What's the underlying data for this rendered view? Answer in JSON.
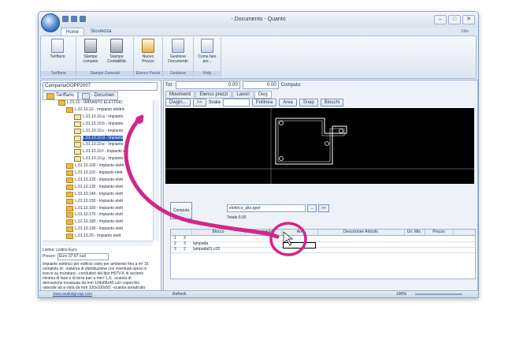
{
  "window": {
    "title": "- Documento - Quanto",
    "ribbon_style": "Stile"
  },
  "ribbon_tabs": [
    "Home",
    "Sicurezza"
  ],
  "ribbon": {
    "buttons": [
      {
        "label": "Tariffario",
        "icon": "tariffario-icon"
      },
      {
        "label": "Stampe computo",
        "icon": "printer-icon"
      },
      {
        "label": "Stampe Contabilità",
        "icon": "printer-icon"
      },
      {
        "label": "Nuovo Prezzo",
        "icon": "new-price-icon"
      },
      {
        "label": "Gestione Documento",
        "icon": "document-icon"
      },
      {
        "label": "Come fare per...",
        "icon": "help-icon"
      }
    ],
    "groups": [
      "Tariffario",
      "Stampe Generali",
      "Elenco Prezzi",
      "Gestione",
      "Help"
    ]
  },
  "left": {
    "combo_value": "CampaniaGOPP2007",
    "tabs": [
      "Tariffario",
      "- Documen"
    ],
    "tree": [
      {
        "text": "L.01.10 - IMPIANTO ELETTRIC",
        "indent": 2,
        "icon": "folder"
      },
      {
        "text": "L.01.10.10 - Impianto elettric",
        "indent": 3,
        "icon": "folder"
      },
      {
        "text": "L.01.10.10.a - Impianto",
        "indent": 4,
        "icon": "item"
      },
      {
        "text": "L.01.10.10.b - Impianto",
        "indent": 4,
        "icon": "item"
      },
      {
        "text": "L.01.10.10.c - Impianto",
        "indent": 4,
        "icon": "item"
      },
      {
        "text": "L.01.10.10.d - Impianto",
        "indent": 4,
        "icon": "item",
        "selected": true
      },
      {
        "text": "L.01.10.10.e - Impianto",
        "indent": 4,
        "icon": "item"
      },
      {
        "text": "L.01.10.10.f - Impianto e",
        "indent": 4,
        "icon": "item"
      },
      {
        "text": "L.01.10.10.g - Impianto",
        "indent": 4,
        "icon": "item"
      },
      {
        "text": "L.01.10.100 - Impianto elettr",
        "indent": 3,
        "icon": "folder"
      },
      {
        "text": "L.01.10.110 - Impianto elett",
        "indent": 3,
        "icon": "folder"
      },
      {
        "text": "L.01.10.120 - Impianto elett",
        "indent": 3,
        "icon": "folder"
      },
      {
        "text": "L.01.10.130 - Impianto elett",
        "indent": 3,
        "icon": "folder"
      },
      {
        "text": "L.01.10.140 - Impianto elett",
        "indent": 3,
        "icon": "folder"
      },
      {
        "text": "L.01.10.150 - Impianto elett",
        "indent": 3,
        "icon": "folder"
      },
      {
        "text": "L.01.10.160 - Impianto elett",
        "indent": 3,
        "icon": "folder"
      },
      {
        "text": "L.01.10.170 - Impianto elett",
        "indent": 3,
        "icon": "folder"
      },
      {
        "text": "L.01.10.180 - Impianto elett",
        "indent": 3,
        "icon": "folder"
      },
      {
        "text": "L.01.10.190 - Impianto elett",
        "indent": 3,
        "icon": "folder"
      },
      {
        "text": "L.01.10.20 - Impianto elett",
        "indent": 3,
        "icon": "folder"
      }
    ],
    "listino_label": "Listino:",
    "listino_value": "Listino Euro",
    "prezzo_label": "Prezzo:",
    "prezzo_value": "Euro 37.97 cad",
    "description": "Impianto elettrico per edificio civile per ambiente fino a m² 16 completo di: -sistema di distribuzione con eventuali opere in tracce su muratura; -conduttori del tipo H07V-K di sezione minima di fase e di terra pari a mm² 1,5; -scatola di derivazione incassata da mm 104x68x45 con coperchio opposte ad a vista da mm 100x100x50; -scatola portafrutto incassata a muro 3 posti oppure se a vista da mm 86x52; -supporto 1 posto con viti vincolanti per scatola 3 posti; -frutto, serie commerciale; -placca in materiale plastico o"
  },
  "right": {
    "tot_label": "Tot:",
    "tot_value1": "0.00",
    "tot_value2": "0.00",
    "computo_label": "Computo:",
    "tabs": [
      "Movimenti",
      "Elenco prezzi",
      "Lavori",
      "Dwg"
    ],
    "dwg_buttons": {
      "dwgin": "Dwgin...",
      "next": ">>",
      "scala": "Scala",
      "pollinea": "Pollinea",
      "area": "Area",
      "snap": "Snap",
      "blocchi": "Blocchi"
    },
    "computa_label": "Computa",
    "file_select": "elettrico_alto.qpef",
    "file_btn1": "...",
    "file_btn2": ">>",
    "totale": "Totale:0.00",
    "grid_headers": [
      "",
      "Blocco",
      "Commento",
      "Art",
      "Descrizione Articolo",
      "Un. Mis.",
      "Prezzo"
    ],
    "grid_rows": [
      {
        "n": "1",
        "q": "3",
        "blocco": "",
        "art": ""
      },
      {
        "n": "2",
        "q": "3",
        "blocco": "lampada",
        "art": ""
      },
      {
        "n": "3",
        "q": "2",
        "blocco": "lampada01-c02",
        "art": ""
      }
    ]
  },
  "status": {
    "url": "www.analistgroup.com",
    "refresh": "Refresh",
    "zoom": "100%"
  },
  "colors": {
    "annotation": "#d1278a",
    "selection": "#2a5ab6",
    "canvas": "#000000"
  }
}
